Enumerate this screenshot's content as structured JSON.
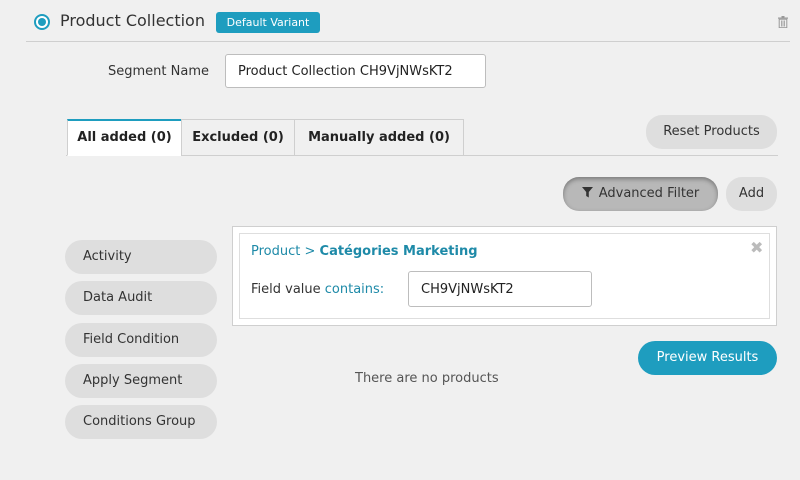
{
  "header": {
    "title": "Product Collection",
    "variant_badge": "Default Variant"
  },
  "segment": {
    "label": "Segment Name",
    "value": "Product Collection CH9VjNWsKT2"
  },
  "tabs": [
    {
      "label": "All added (0)",
      "active": true
    },
    {
      "label": "Excluded (0)",
      "active": false
    },
    {
      "label": "Manually added (0)",
      "active": false
    }
  ],
  "actions": {
    "reset_products": "Reset Products",
    "advanced_filter": "Advanced Filter",
    "add": "Add",
    "preview_results": "Preview Results"
  },
  "sidebar": {
    "items": [
      {
        "label": "Activity"
      },
      {
        "label": "Data Audit"
      },
      {
        "label": "Field Condition"
      },
      {
        "label": "Apply Segment"
      },
      {
        "label": "Conditions Group"
      }
    ]
  },
  "filter": {
    "path_prefix": "Product > ",
    "path_field": "Catégories Marketing",
    "field_label": "Field value ",
    "operator": "contains:",
    "value": "CH9VjNWsKT2"
  },
  "results": {
    "empty_text": "There are no products"
  },
  "colors": {
    "accent": "#1e9dbf",
    "link": "#1e8aa8",
    "background": "#f0f0f0"
  },
  "icons": {
    "radio": "radio-selected-icon",
    "trash": "trash-icon",
    "filter": "filter-funnel-icon",
    "close": "close-icon"
  }
}
